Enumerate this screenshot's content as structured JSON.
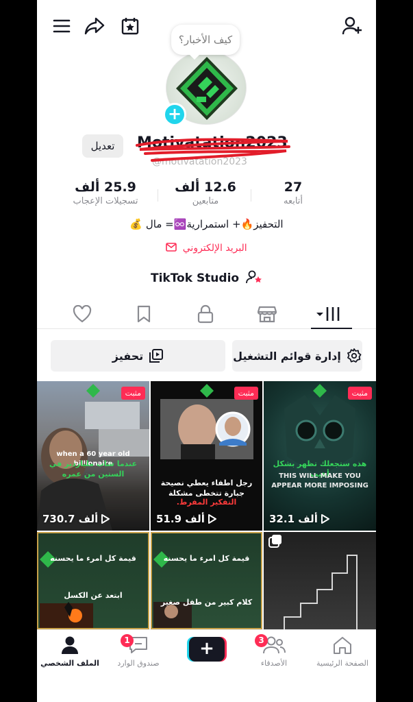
{
  "bubble_text": "كيف الأخبار؟",
  "profile": {
    "username": "Motivatation2023",
    "handle": "@motivatation2023",
    "edit_label": "تعديل",
    "stats": {
      "likes_value": "25.9 ألف",
      "likes_label": "تسجيلات الإعجاب",
      "followers_value": "12.6 ألف",
      "followers_label": "متابعين",
      "following_value": "27",
      "following_label": "أتابعه"
    },
    "bio": "التحفيز🔥+ استمرارية♾️= مال 💰",
    "email_label": "البريد الإلكتروني",
    "studio_label": "TikTok Studio"
  },
  "actions": {
    "playlists_label": "إدارة قوائم التشغيل",
    "motivation_label": "تحفيز"
  },
  "videos": [
    {
      "pinned": "مثبت",
      "views": "730.7 ألف",
      "caption_top": "when a 60 year old billionaire",
      "caption": "عندما شاب ملياردير في الستين من عمره"
    },
    {
      "pinned": "مثبت",
      "views": "51.9 ألف",
      "caption": "رجل اطفاء يعطي نصيحة جبارة تتخطى مشكلة",
      "caption_red": "التفكير المفرط."
    },
    {
      "pinned": "مثبت",
      "views": "32.1 ألف",
      "caption": "هذه ستجعلك تظهر بشكل أهيب",
      "caption_en": "THIS WILL MAKE YOU APPEAR MORE IMPOSING"
    },
    {
      "title": "قيمة كل امرء ما يحسنه",
      "caption": "ابتعد عن الكسل"
    },
    {
      "title": "قيمة كل امرء ما يحسنه",
      "caption": "كلام كبير من طفل صغير"
    },
    {}
  ],
  "nav": {
    "home": "الصفحة الرئيسية",
    "friends": "الأصدقاء",
    "friends_badge": "3",
    "inbox": "صندوق الوارد",
    "inbox_badge": "1",
    "profile": "الملف الشخصي",
    "create": "+"
  },
  "colors": {
    "accent": "#fe2c55",
    "cyan": "#20d5ec",
    "text": "#161823"
  }
}
